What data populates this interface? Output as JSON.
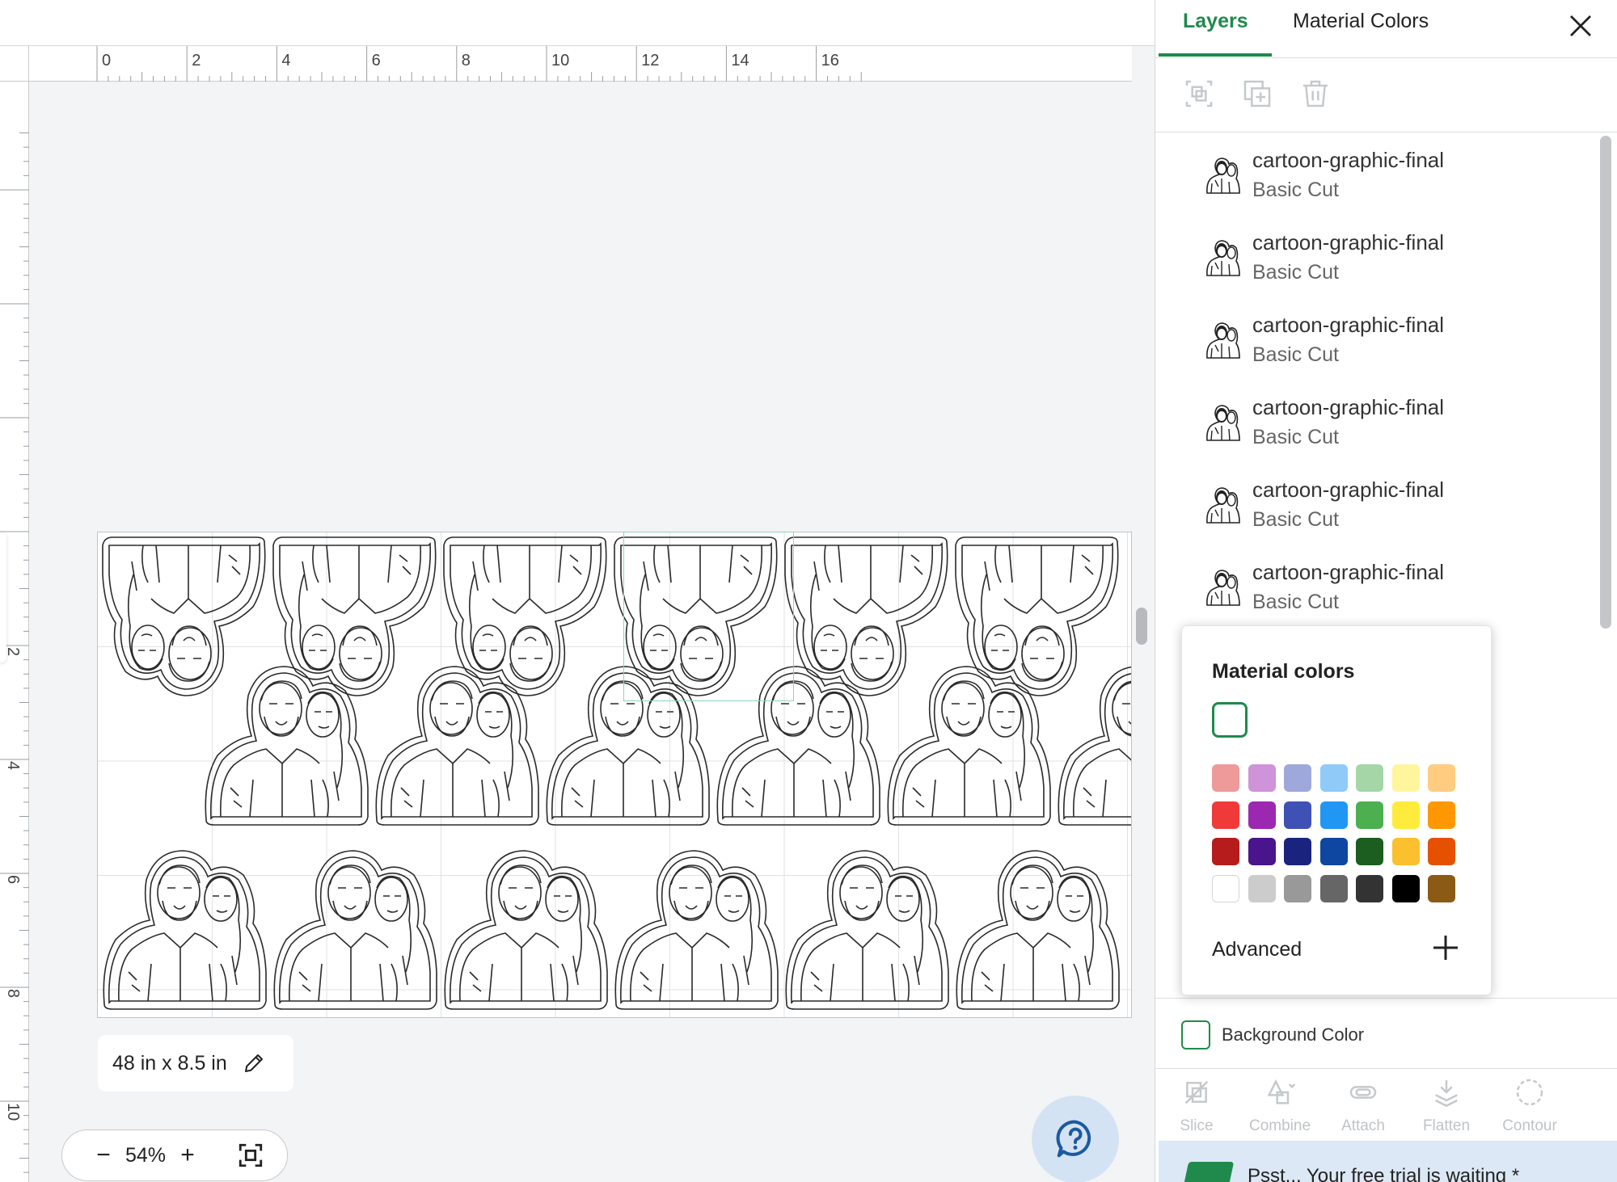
{
  "ruler": {
    "h_labels": [
      "0",
      "2",
      "4",
      "6",
      "8",
      "10",
      "12",
      "14",
      "16"
    ],
    "v_labels": [
      "2",
      "4",
      "6",
      "8",
      "10"
    ]
  },
  "canvas": {
    "size_label": "48 in x 8.5 in",
    "edit_icon": "pencil-icon",
    "zoom": "54%",
    "zoom_minus": "−",
    "zoom_plus": "+",
    "fit_icon": "fit-to-screen-icon",
    "help_icon": "question-icon"
  },
  "panel": {
    "tabs": [
      {
        "label": "Layers",
        "active": true
      },
      {
        "label": "Material Colors",
        "active": false
      }
    ],
    "close_icon": "close-icon",
    "tools": [
      "group-icon",
      "duplicate-icon",
      "delete-icon"
    ],
    "layers": [
      {
        "name": "cartoon-graphic-final",
        "operation": "Basic Cut"
      },
      {
        "name": "cartoon-graphic-final",
        "operation": "Basic Cut"
      },
      {
        "name": "cartoon-graphic-final",
        "operation": "Basic Cut"
      },
      {
        "name": "cartoon-graphic-final",
        "operation": "Basic Cut"
      },
      {
        "name": "cartoon-graphic-final",
        "operation": "Basic Cut"
      },
      {
        "name": "cartoon-graphic-final",
        "operation": "Basic Cut"
      }
    ],
    "background_color_label": "Background Color",
    "actions": [
      {
        "label": "Slice",
        "icon": "slice-icon"
      },
      {
        "label": "Combine",
        "icon": "combine-icon"
      },
      {
        "label": "Attach",
        "icon": "attach-icon"
      },
      {
        "label": "Flatten",
        "icon": "flatten-icon"
      },
      {
        "label": "Contour",
        "icon": "contour-icon"
      }
    ],
    "trial_banner": "Psst... Your free trial is waiting *"
  },
  "material_colors_popover": {
    "title": "Material colors",
    "selected_color": "#ffffff",
    "accent": "#1f8a4c",
    "palette": [
      [
        "#ef9a9a",
        "#ce93d8",
        "#9fa8da",
        "#90caf9",
        "#a5d6a7",
        "#fff59d",
        "#ffcc80"
      ],
      [
        "#f03a3a",
        "#9c27b0",
        "#3f51b5",
        "#2196f3",
        "#4caf50",
        "#ffeb3b",
        "#ff9800"
      ],
      [
        "#b71c1c",
        "#4a148c",
        "#1a237e",
        "#0d47a1",
        "#1b5e20",
        "#fbc02d",
        "#e65100"
      ],
      [
        "#ffffff",
        "#cccccc",
        "#999999",
        "#666666",
        "#333333",
        "#000000",
        "#8b5a14"
      ]
    ],
    "advanced_label": "Advanced",
    "advanced_icon": "plus-icon"
  }
}
